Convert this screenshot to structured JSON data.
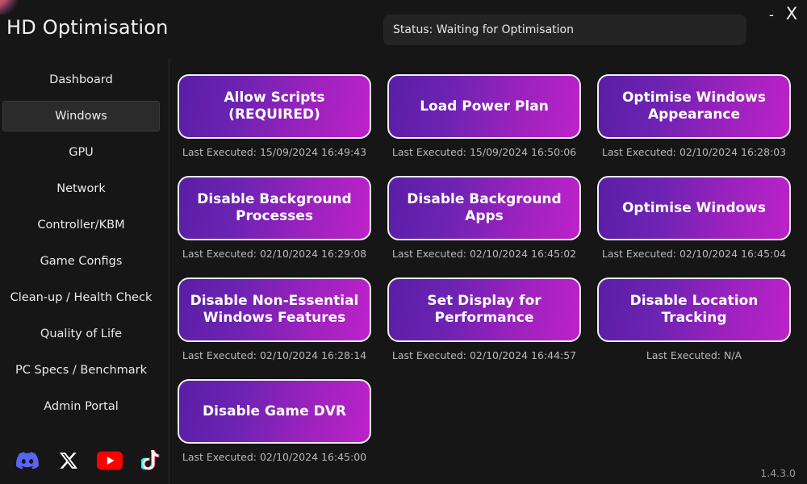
{
  "window": {
    "title": "HD Optimisation",
    "logo_icon": "app-logo-icon",
    "minimise_label": "-",
    "close_label": "X",
    "version": "1.4.3.0"
  },
  "status": {
    "text": "Status: Waiting for Optimisation"
  },
  "sidebar": {
    "items": [
      {
        "label": "Dashboard",
        "active": false
      },
      {
        "label": "Windows",
        "active": true
      },
      {
        "label": "GPU",
        "active": false
      },
      {
        "label": "Network",
        "active": false
      },
      {
        "label": "Controller/KBM",
        "active": false
      },
      {
        "label": "Game Configs",
        "active": false
      },
      {
        "label": "Clean-up / Health Check",
        "active": false
      },
      {
        "label": "Quality of Life",
        "active": false
      },
      {
        "label": "PC Specs / Benchmark",
        "active": false
      },
      {
        "label": "Admin Portal",
        "active": false
      }
    ],
    "socials": [
      {
        "name": "discord-icon",
        "color": "#5865F2"
      },
      {
        "name": "x-twitter-icon",
        "color": "#FFFFFF"
      },
      {
        "name": "youtube-icon",
        "color": "#FF0000"
      },
      {
        "name": "tiktok-icon",
        "color": "#FFFFFF"
      }
    ]
  },
  "main": {
    "buttons": [
      {
        "label": "Allow Scripts (REQUIRED)",
        "executed": "Last Executed: 15/09/2024 16:49:43"
      },
      {
        "label": "Load Power Plan",
        "executed": "Last Executed: 15/09/2024 16:50:06"
      },
      {
        "label": "Optimise Windows Appearance",
        "executed": "Last Executed: 02/10/2024 16:28:03"
      },
      {
        "label": "Disable Background Processes",
        "executed": "Last Executed: 02/10/2024 16:29:08"
      },
      {
        "label": "Disable Background Apps",
        "executed": "Last Executed: 02/10/2024 16:45:02"
      },
      {
        "label": "Optimise Windows",
        "executed": "Last Executed: 02/10/2024 16:45:04"
      },
      {
        "label": "Disable Non-Essential Windows Features",
        "executed": "Last Executed: 02/10/2024 16:28:14"
      },
      {
        "label": "Set Display for Performance",
        "executed": "Last Executed: 02/10/2024 16:44:57"
      },
      {
        "label": "Disable Location Tracking",
        "executed": "Last Executed: N/A"
      },
      {
        "label": "Disable Game DVR",
        "executed": "Last Executed: 02/10/2024 16:45:00"
      }
    ]
  },
  "colors": {
    "background": "#161616",
    "button_gradient_start": "#5a1ea6",
    "button_gradient_end": "#bd22c9",
    "status_box": "#242424",
    "active_nav": "#2b2b2b"
  }
}
